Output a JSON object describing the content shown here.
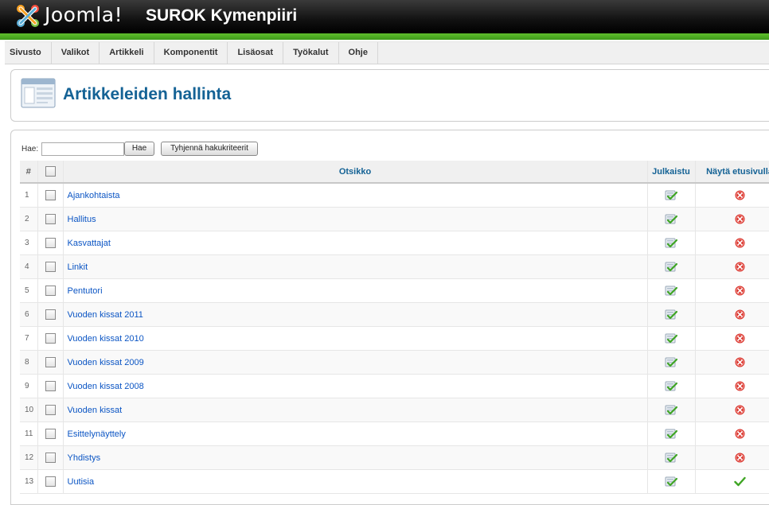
{
  "header": {
    "brand": "Joomla!",
    "site_name": "SUROK Kymenpiiri"
  },
  "menu": [
    "Sivusto",
    "Valikot",
    "Artikkeli",
    "Komponentit",
    "Lisäosat",
    "Työkalut",
    "Ohje"
  ],
  "page": {
    "title": "Artikkeleiden hallinta"
  },
  "filter": {
    "label": "Hae:",
    "value": "",
    "search_button": "Hae",
    "clear_button": "Tyhjennä hakukriteerit"
  },
  "table": {
    "headers": {
      "num": "#",
      "title": "Otsikko",
      "published": "Julkaistu",
      "frontpage": "Näytä etusivulla"
    },
    "rows": [
      {
        "num": "1",
        "title": "Ajankohtaista",
        "published": true,
        "frontpage": false
      },
      {
        "num": "2",
        "title": "Hallitus",
        "published": true,
        "frontpage": false
      },
      {
        "num": "3",
        "title": "Kasvattajat",
        "published": true,
        "frontpage": false
      },
      {
        "num": "4",
        "title": "Linkit",
        "published": true,
        "frontpage": false
      },
      {
        "num": "5",
        "title": "Pentutori",
        "published": true,
        "frontpage": false
      },
      {
        "num": "6",
        "title": "Vuoden kissat 2011",
        "published": true,
        "frontpage": false
      },
      {
        "num": "7",
        "title": "Vuoden kissat 2010",
        "published": true,
        "frontpage": false
      },
      {
        "num": "8",
        "title": "Vuoden kissat 2009",
        "published": true,
        "frontpage": false
      },
      {
        "num": "9",
        "title": "Vuoden kissat 2008",
        "published": true,
        "frontpage": false
      },
      {
        "num": "10",
        "title": "Vuoden kissat",
        "published": true,
        "frontpage": false
      },
      {
        "num": "11",
        "title": "Esittelynäyttely",
        "published": true,
        "frontpage": false
      },
      {
        "num": "12",
        "title": "Yhdistys",
        "published": true,
        "frontpage": false
      },
      {
        "num": "13",
        "title": "Uutisia",
        "published": true,
        "frontpage": true
      }
    ]
  },
  "colors": {
    "header_bg": "#111111",
    "accent_green": "#4fae22",
    "title_blue": "#146295",
    "link_blue": "#0b55c4",
    "unpublish_red": "#d9322b"
  },
  "icons": {
    "logo": "joomla-logo-icon",
    "page": "article-manager-icon",
    "published": "published-check-icon",
    "not_frontpage": "red-x-icon",
    "frontpage": "green-check-icon"
  }
}
